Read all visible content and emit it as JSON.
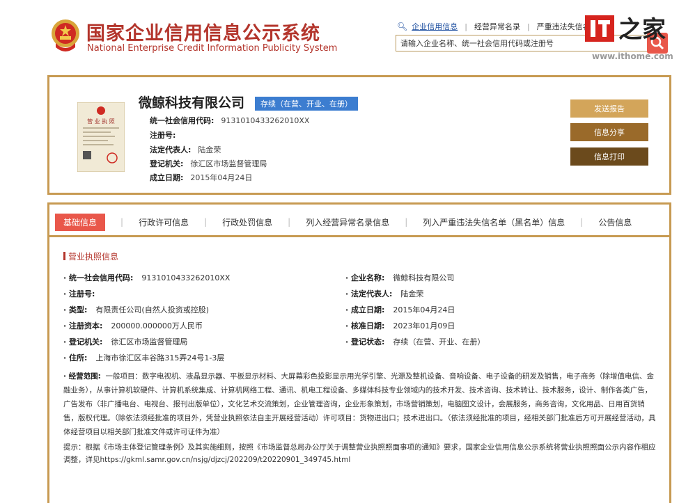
{
  "header": {
    "title_cn": "国家企业信用信息公示系统",
    "title_en": "National Enterprise Credit Information Publicity System",
    "nav": [
      {
        "label": "企业信用信息",
        "active": true
      },
      {
        "label": "经营异常名录",
        "active": false
      },
      {
        "label": "严重违法失信名单",
        "active": false
      }
    ],
    "search_placeholder": "请输入企业名称、统一社会信用代码或注册号"
  },
  "watermark": {
    "text": "IT之家",
    "url": "www.ithome.com"
  },
  "company": {
    "name": "微鲸科技有限公司",
    "status": "存续（在营、开业、在册）",
    "fields": [
      {
        "label": "统一社会信用代码:",
        "value": "9131010433262010XX"
      },
      {
        "label": "注册号:",
        "value": ""
      },
      {
        "label": "法定代表人:",
        "value": "陆金荣"
      },
      {
        "label": "登记机关:",
        "value": "徐汇区市场监督管理局"
      },
      {
        "label": "成立日期:",
        "value": "2015年04月24日"
      }
    ],
    "buttons": {
      "send": "发送报告",
      "share": "信息分享",
      "print": "信息打印"
    },
    "license_text": "营业执照"
  },
  "tabs": [
    {
      "label": "基础信息",
      "active": true
    },
    {
      "label": "行政许可信息",
      "active": false
    },
    {
      "label": "行政处罚信息",
      "active": false
    },
    {
      "label": "列入经营异常名录信息",
      "active": false
    },
    {
      "label": "列入严重违法失信名单（黑名单）信息",
      "active": false
    },
    {
      "label": "公告信息",
      "active": false
    }
  ],
  "license": {
    "section_title": "营业执照信息",
    "left": [
      {
        "label": "· 统一社会信用代码:",
        "value": "9131010433262010XX"
      },
      {
        "label": "· 注册号:",
        "value": ""
      },
      {
        "label": "· 类型:",
        "value": "有限责任公司(自然人投资或控股)"
      },
      {
        "label": "· 注册资本:",
        "value": "200000.000000万人民币"
      },
      {
        "label": "· 登记机关:",
        "value": "徐汇区市场监督管理局"
      },
      {
        "label": "· 住所:",
        "value": "上海市徐汇区丰谷路315弄24号1-3层"
      }
    ],
    "right": [
      {
        "label": "· 企业名称:",
        "value": "微鲸科技有限公司"
      },
      {
        "label": "· 法定代表人:",
        "value": "陆金荣"
      },
      {
        "label": "· 成立日期:",
        "value": "2015年04月24日"
      },
      {
        "label": "· 核准日期:",
        "value": "2023年01月09日"
      },
      {
        "label": "· 登记状态:",
        "value": "存续（在营、开业、在册）"
      }
    ],
    "scope_label": "· 经营范围:",
    "scope_text": "一般项目：数字电视机、液晶显示器、平板显示材料、大屏幕彩色投影显示用光学引擎、光源及整机设备、音响设备、电子设备的研发及销售，电子商务（除增值电信、金融业务），从事计算机软硬件、计算机系统集成、计算机网络工程、通讯、机电工程设备、多媒体科技专业领域内的技术开发、技术咨询、技术转让、技术服务，设计、制作各类广告，广告发布（非广播电台、电视台、报刊出版单位），文化艺术交流策划，企业管理咨询，企业形象策划，市场营销策划，电脑图文设计，会展服务，商务咨询，文化用品、日用百货销售，版权代理。（除依法须经批准的项目外，凭营业执照依法自主开展经营活动）许可项目：货物进出口；技术进出口。（依法须经批准的项目，经相关部门批准后方可开展经营活动，具体经营项目以相关部门批准文件或许可证件为准）",
    "tip": "提示：根据《市场主体登记管理条例》及其实施细则，按照《市场监督总局办公厅关于调整营业执照照面事项的通知》要求，国家企业信用信息公示系统将营业执照照面公示内容作相应调整，详见https://gkml.samr.gov.cn/nsjg/djzcj/202209/t20220901_349745.html"
  }
}
